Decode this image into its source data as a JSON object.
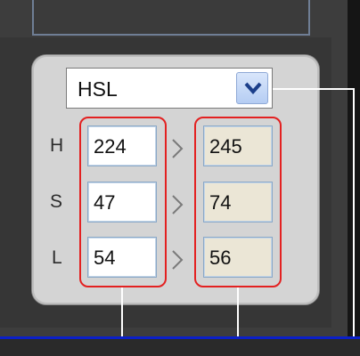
{
  "color_picker": {
    "mode_select": {
      "value": "HSL"
    },
    "rows": [
      {
        "label": "H",
        "input": "224",
        "output": "245"
      },
      {
        "label": "S",
        "input": "47",
        "output": "74"
      },
      {
        "label": "L",
        "input": "54",
        "output": "56"
      }
    ]
  },
  "colors": {
    "highlight_outline": "#e32121",
    "output_field_bg": "#ebe6d6",
    "accent_line": "#0b1fc9"
  },
  "icons": [
    "chevron-down-icon",
    "chevron-right-icon"
  ]
}
